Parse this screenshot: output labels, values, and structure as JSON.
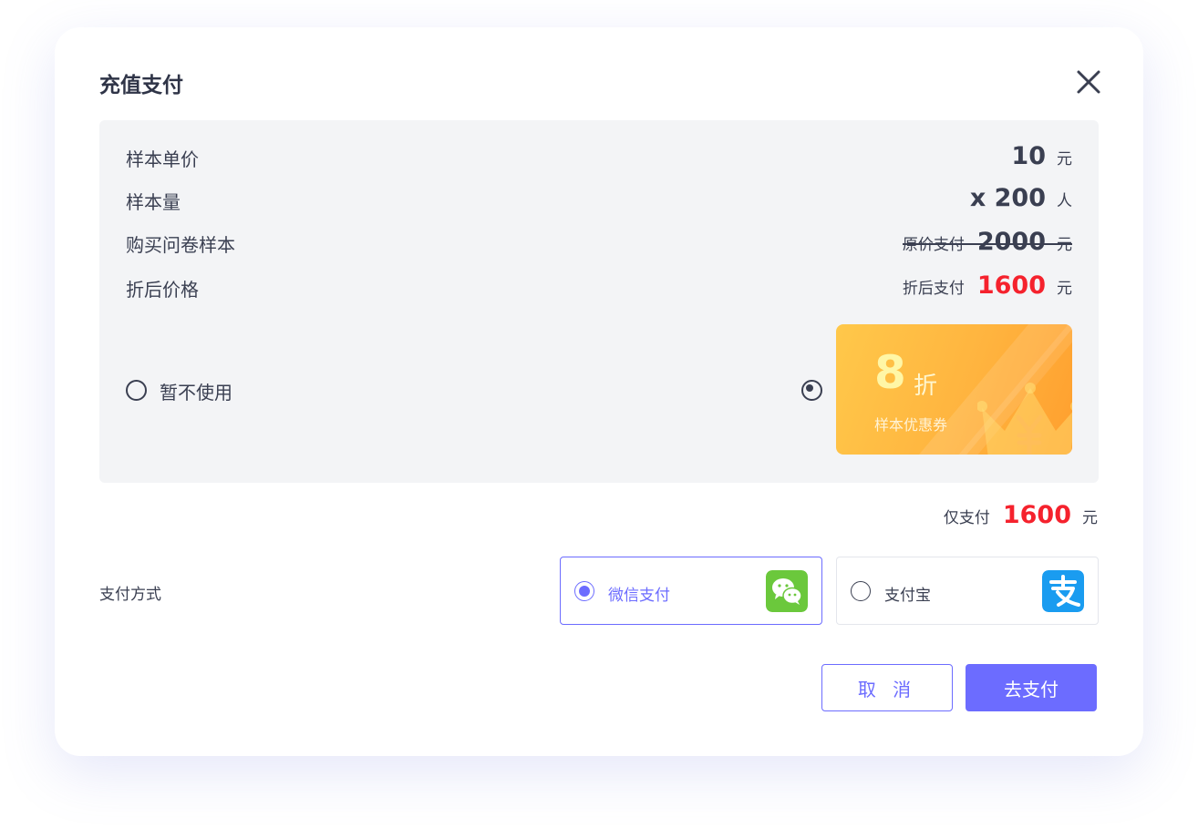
{
  "dialog": {
    "title": "充值支付"
  },
  "summary": {
    "rows": [
      {
        "label": "样本单价",
        "value": "10",
        "unit": "元"
      },
      {
        "label": "样本量",
        "value": "x 200",
        "unit": "人"
      },
      {
        "label": "购买问卷样本",
        "prefix": "原价支付",
        "value": "2000",
        "unit": "元"
      },
      {
        "label": "折后价格",
        "prefix": "折后支付",
        "value": "1600",
        "unit": "元"
      }
    ]
  },
  "coupon_options": {
    "none_label": "暂不使用",
    "none_selected": false,
    "coupon_selected": true,
    "coupon": {
      "discount": "8",
      "discount_unit": "折",
      "name": "样本优惠券"
    }
  },
  "total": {
    "prefix": "仅支付",
    "value": "1600",
    "unit": "元"
  },
  "payment": {
    "label": "支付方式",
    "methods": [
      {
        "name": "微信支付",
        "selected": true,
        "icon": "wechat-icon",
        "color": "#6bc83c"
      },
      {
        "name": "支付宝",
        "selected": false,
        "icon": "alipay-icon",
        "color": "#1a9cf0"
      }
    ]
  },
  "buttons": {
    "cancel": "取 消",
    "pay": "去支付"
  },
  "colors": {
    "accent": "#6c6cff",
    "price_red": "#f5222d",
    "coupon_orange": "#ffb43f"
  }
}
